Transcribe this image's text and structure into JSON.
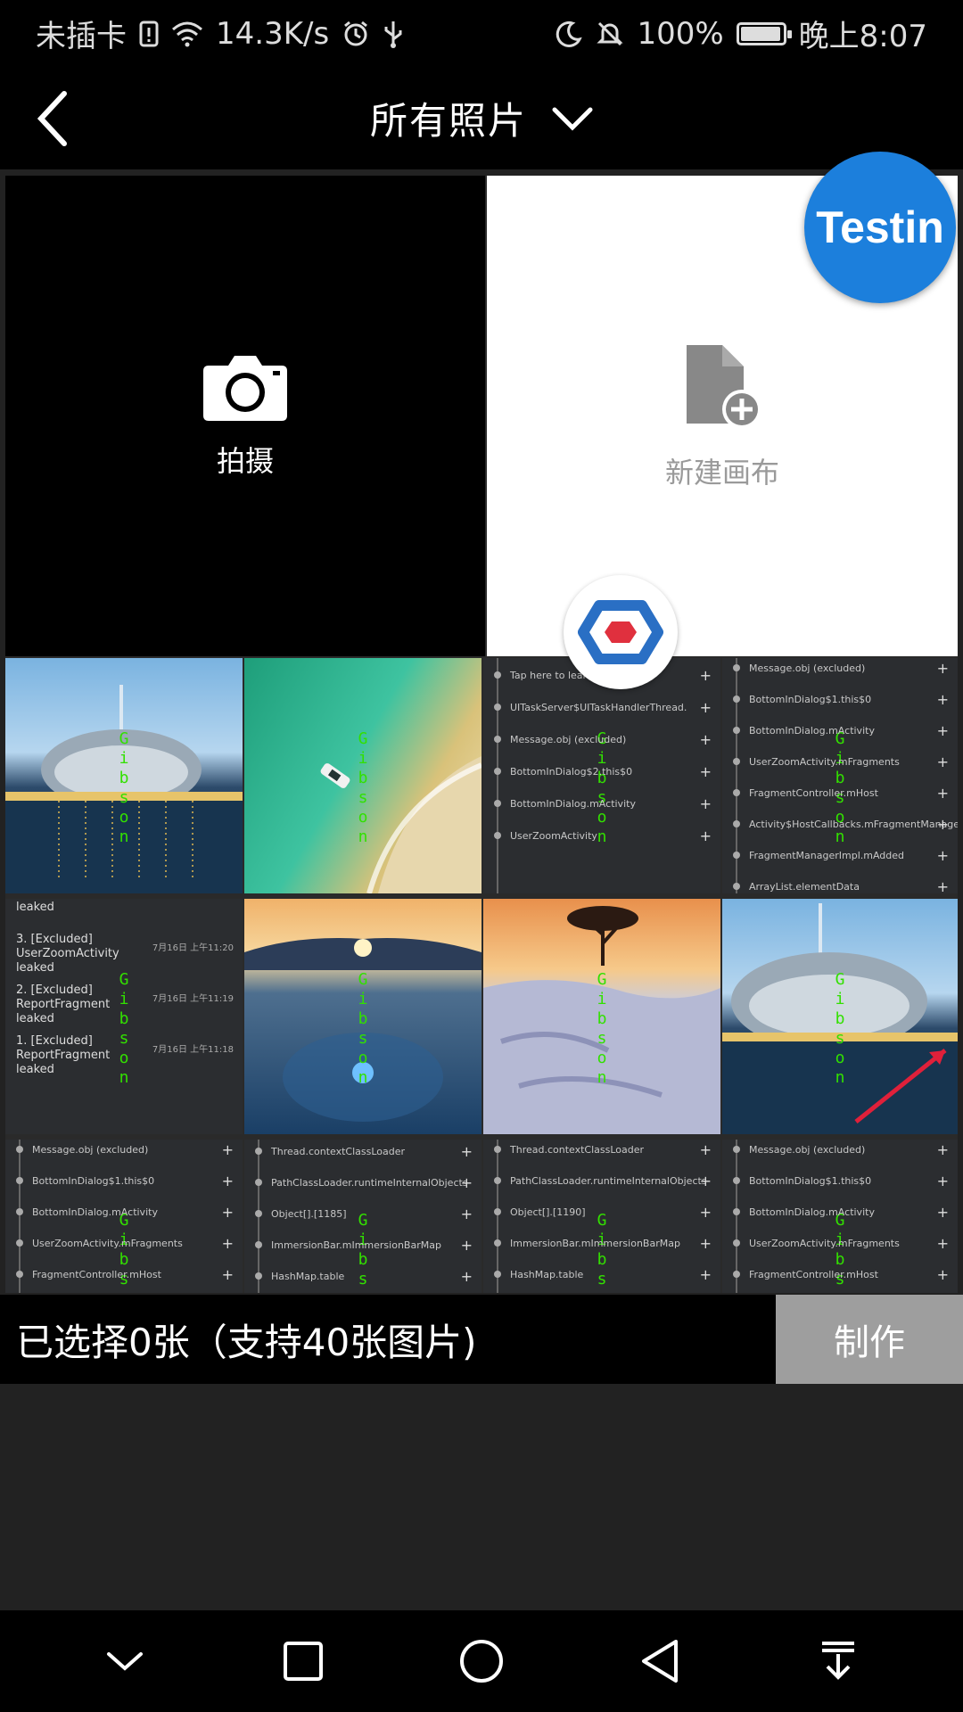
{
  "status_bar": {
    "carrier": "未插卡",
    "speed": "14.3K/s",
    "battery": "100%",
    "battery_level": 1.0,
    "time": "晚上8:07"
  },
  "header": {
    "title": "所有照片"
  },
  "grid": {
    "camera_label": "拍摄",
    "new_canvas_label": "新建画布",
    "watermark": "Gibson",
    "leak_items": [
      {
        "title": "leaked",
        "date": ""
      },
      {
        "title": "3. [Excluded] UserZoomActivity leaked",
        "date": "7月16日 上午11:20"
      },
      {
        "title": "2. [Excluded] ReportFragment leaked",
        "date": "7月16日 上午11:19"
      },
      {
        "title": "1. [Excluded] ReportFragment leaked",
        "date": "7月16日 上午11:18"
      }
    ],
    "code_tile_a": [
      "Tap here to lear",
      "UITaskServer$UITaskHandlerThread.",
      "Message.obj (excluded)",
      "BottomInDialog$2.this$0",
      "BottomInDialog.mActivity",
      "UserZoomActivity"
    ],
    "code_tile_b": [
      "Message.obj (excluded)",
      "BottomInDialog$1.this$0",
      "BottomInDialog.mActivity",
      "UserZoomActivity.mFragments",
      "FragmentController.mHost",
      "Activity$HostCallbacks.mFragmentManager",
      "FragmentManagerImpl.mAdded",
      "ArrayList.elementData"
    ],
    "code_tile_c": [
      "Message.obj (excluded)",
      "BottomInDialog$1.this$0",
      "BottomInDialog.mActivity",
      "UserZoomActivity.mFragments",
      "FragmentController.mHost"
    ],
    "code_tile_d": [
      "Thread.contextClassLoader",
      "PathClassLoader.runtimeInternalObjects",
      "Object[].[1185]",
      "ImmersionBar.mImmersionBarMap",
      "HashMap.table"
    ],
    "code_tile_e": [
      "Thread.contextClassLoader",
      "PathClassLoader.runtimeInternalObjects",
      "Object[].[1190]",
      "ImmersionBar.mImmersionBarMap",
      "HashMap.table"
    ],
    "code_tile_f": [
      "Message.obj (excluded)",
      "BottomInDialog$1.this$0",
      "BottomInDialog.mActivity",
      "UserZoomActivity.mFragments",
      "FragmentController.mHost"
    ]
  },
  "badges": {
    "testin": "Testin"
  },
  "action_bar": {
    "selected_text": "已选择0张（支持40张图片)",
    "make_button": "制作"
  },
  "colors": {
    "testin_blue": "#1c7fdc",
    "make_button_gray": "#9e9e9e",
    "watermark_green": "#32e000"
  },
  "icons": [
    "back-arrow-icon",
    "chevron-down-icon",
    "camera-icon",
    "new-file-icon",
    "hex-logo-icon",
    "nav-collapse-icon",
    "nav-recents-icon",
    "nav-home-icon",
    "nav-back-icon",
    "nav-pulldown-icon"
  ]
}
